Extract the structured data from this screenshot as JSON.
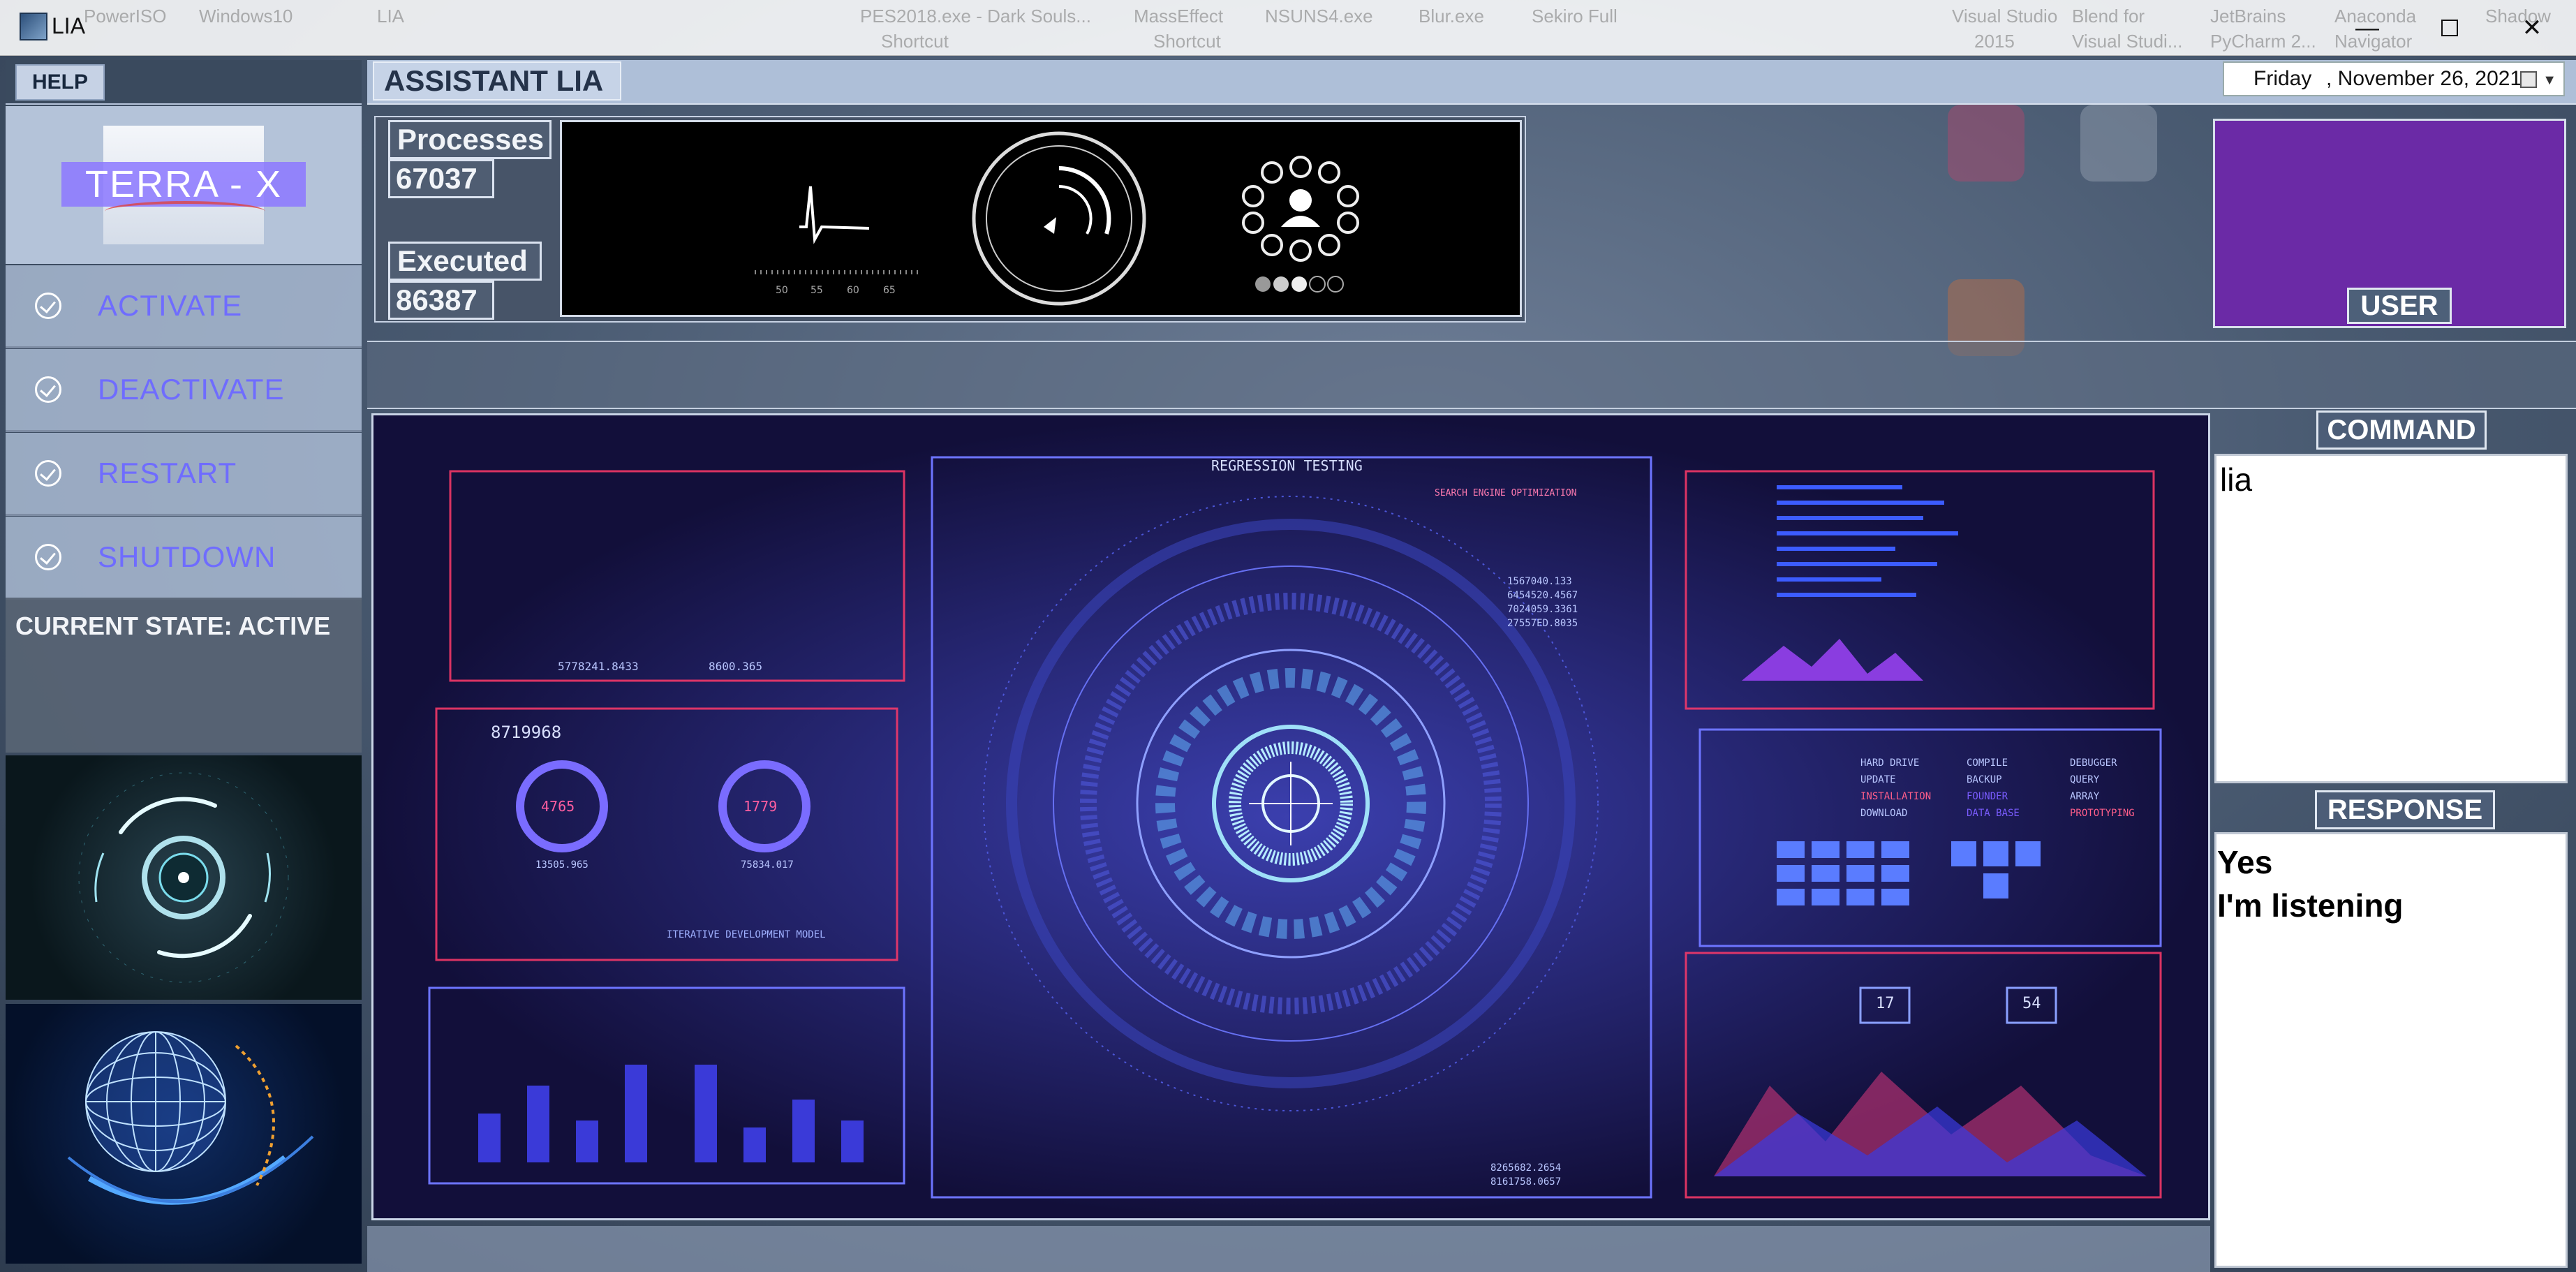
{
  "window": {
    "title": "LIA"
  },
  "taskbar_ghosts": [
    "PowerISO",
    "Windows10",
    "LIA",
    "PES2018.exe - Dark Souls...",
    "MassEffect",
    "NSUNS4.exe",
    "Blur.exe",
    "Sekiro Full",
    "Visual Studio",
    "Blend for",
    "JetBrains",
    "Anaconda",
    "Shadow",
    "Shortcut",
    "Shortcut",
    "2015",
    "Visual Studi...",
    "PyCharm 2...",
    "Navigator"
  ],
  "help": {
    "label": "HELP"
  },
  "logo": {
    "text": "TERRA - X"
  },
  "nav": [
    {
      "label": "ACTIVATE"
    },
    {
      "label": "DEACTIVATE"
    },
    {
      "label": "RESTART"
    },
    {
      "label": "SHUTDOWN"
    }
  ],
  "state": {
    "text": "CURRENT STATE: ACTIVE"
  },
  "header": {
    "title": "ASSISTANT LIA"
  },
  "date": {
    "day": "Friday",
    "rest": ", November 26, 2021"
  },
  "stats": {
    "processes_label": "Processes",
    "processes_value": "67037",
    "executed_label": "Executed",
    "executed_value": "86387"
  },
  "user": {
    "label": "USER"
  },
  "command": {
    "title": "COMMAND",
    "text": "lia"
  },
  "response": {
    "title": "RESPONSE",
    "lines": [
      "Yes",
      "I'm listening"
    ]
  },
  "hud": {
    "title": "REGRESSION TESTING",
    "subtitle": "SEARCH ENGINE OPTIMIZATION",
    "num1": "5778241.8433",
    "num2": "8600.365",
    "num3": "8719968",
    "ring1": "4765",
    "ring2": "1779",
    "ring1_sub": "13505.965",
    "ring2_sub": "75834.017",
    "iterative": "ITERATIVE DEVELOPMENT MODEL",
    "menu_col1": [
      "HARD DRIVE",
      "UPDATE",
      "INSTALLATION",
      "DOWNLOAD"
    ],
    "menu_col2": [
      "COMPILE",
      "BACKUP",
      "FOUNDER",
      "DATA BASE"
    ],
    "menu_col3": [
      "DEBUGGER",
      "QUERY",
      "ARRAY",
      "PROTOTYPING"
    ],
    "box1": "17",
    "box2": "54",
    "num4": "1567040.133",
    "num5": "6454520.4567",
    "num6": "7024059.3361",
    "num7": "27557ED.8035",
    "num8": "8265682.2654",
    "num9": "8161758.0657"
  },
  "vis": {
    "ticks": [
      "50",
      "55",
      "60",
      "65"
    ]
  },
  "colors": {
    "accent": "#6f6cff",
    "user_panel": "#6b2aa6",
    "hud_bg": "#120f3a"
  }
}
